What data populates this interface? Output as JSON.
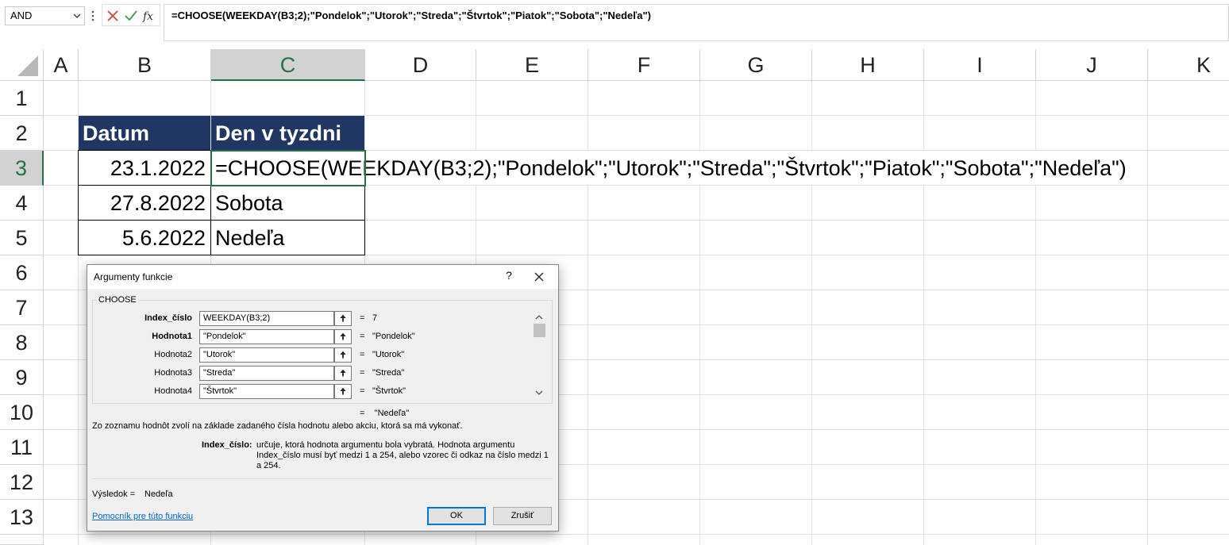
{
  "formula_bar": {
    "name_box": "AND",
    "cancel_icon": "x-icon",
    "enter_icon": "check-icon",
    "fx_label": "fx",
    "formula": "=CHOOSE(WEEKDAY(B3;2);\"Pondelok\";\"Utorok\";\"Streda\";\"Štvrtok\";\"Piatok\";\"Sobota\";\"Nedeľa\")"
  },
  "grid": {
    "columns": [
      "A",
      "B",
      "C",
      "D",
      "E",
      "F",
      "G",
      "H",
      "I",
      "J",
      "K"
    ],
    "rows": [
      "1",
      "2",
      "3",
      "4",
      "5",
      "6",
      "7",
      "8",
      "9",
      "10",
      "11",
      "12",
      "13"
    ],
    "selected_column": "C",
    "selected_row": "3"
  },
  "table": {
    "header_datum": "Datum",
    "header_den": "Den v tyzdni",
    "b3": "23.1.2022",
    "c3": "=CHOOSE(WEEKDAY(B3;2);\"Pondelok\";\"Utorok\";\"Streda\";\"Štvrtok\";\"Piatok\";\"Sobota\";\"Nedeľa\")",
    "b4": "27.8.2022",
    "c4": "Sobota",
    "b5": "5.6.2022",
    "c5": "Nedeľa",
    "header_bg": "#203764",
    "accent": "#217346"
  },
  "dialog": {
    "title": "Argumenty funkcie",
    "help": "?",
    "function_name": "CHOOSE",
    "args": [
      {
        "label": "Index_číslo",
        "value": "WEEKDAY(B3;2)",
        "result": "7"
      },
      {
        "label": "Hodnota1",
        "value": "\"Pondelok\"",
        "result": "\"Pondelok\""
      },
      {
        "label": "Hodnota2",
        "value": "\"Utorok\"",
        "result": "\"Utorok\""
      },
      {
        "label": "Hodnota3",
        "value": "\"Streda\"",
        "result": "\"Streda\""
      },
      {
        "label": "Hodnota4",
        "value": "\"Štvrtok\"",
        "result": "\"Štvrtok\""
      }
    ],
    "equals": "=",
    "overall_result": "\"Nedeľa\"",
    "description": "Zo zoznamu hodnôt zvolí na základe zadaného čísla hodnotu alebo akciu, ktorá sa má vykonať.",
    "arg_desc_label": "Index_číslo:",
    "arg_desc_line1": "určuje, ktorá hodnota argumentu bola vybratá. Hodnota argumentu",
    "arg_desc_line2": "Index_číslo musí byť medzi 1 a 254, alebo vzorec či odkaz na číslo medzi 1",
    "arg_desc_line3": "a 254.",
    "result_label": "Výsledok =",
    "result_value": "Nedeľa",
    "help_link": "Pomocník pre túto funkciu",
    "ok": "OK",
    "cancel": "Zrušiť"
  }
}
